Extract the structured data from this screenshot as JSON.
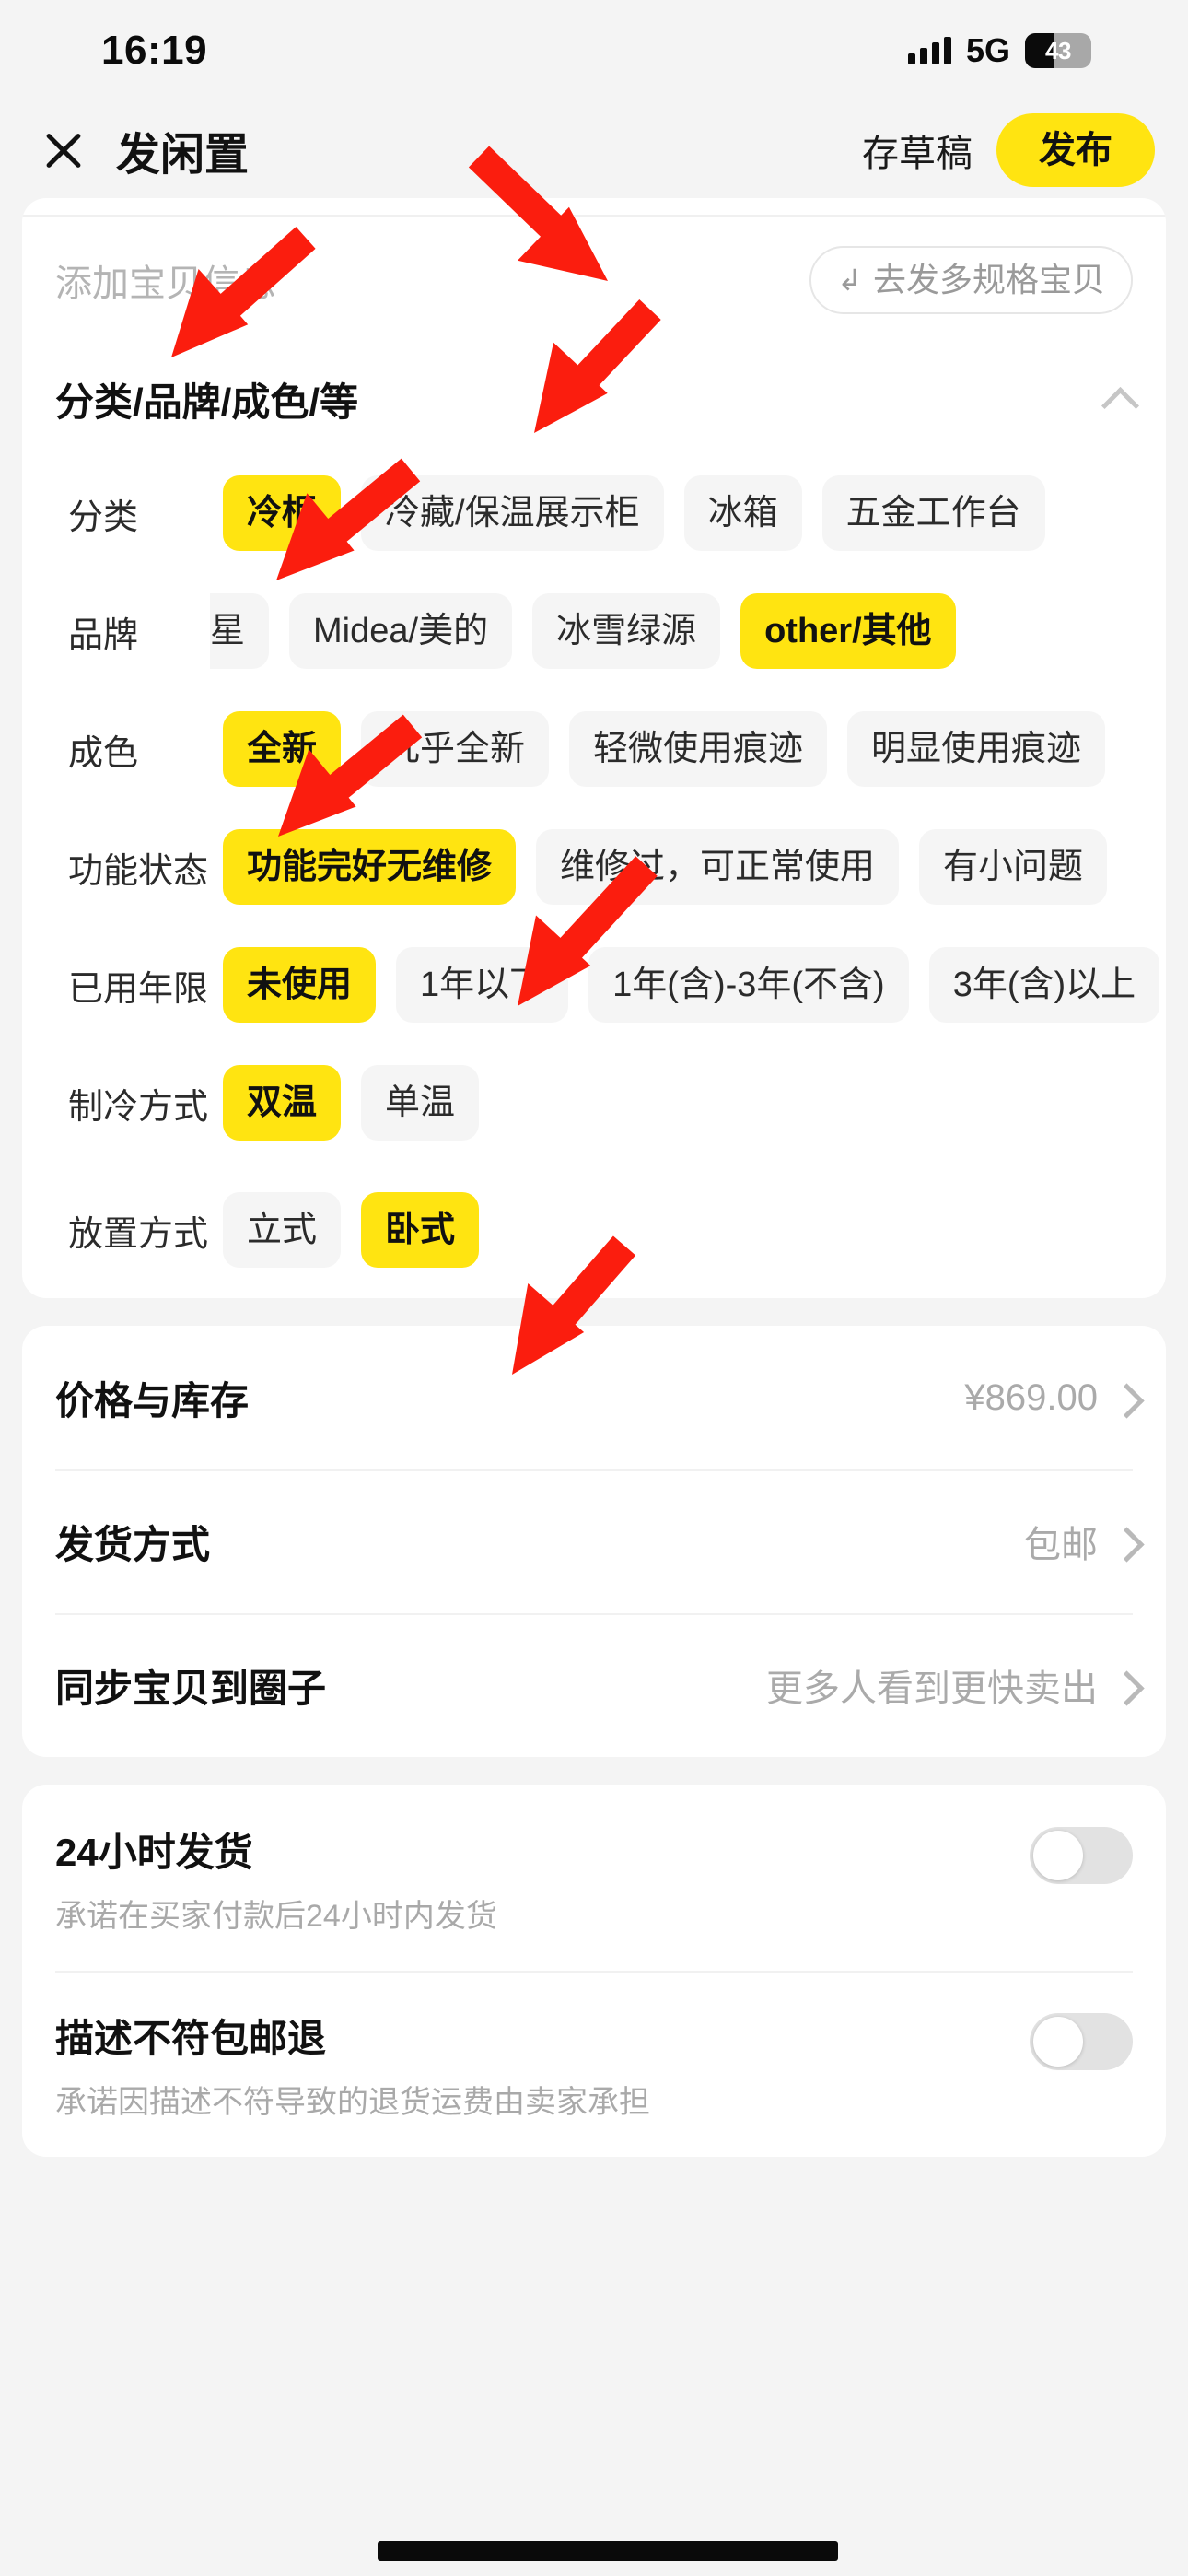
{
  "status_bar": {
    "time": "16:19",
    "network": "5G",
    "battery_percent": "43",
    "signal_icon": "signal-bars-icon"
  },
  "nav": {
    "close_icon": "close-icon",
    "title": "发闲置",
    "draft_label": "存草稿",
    "publish_label": "发布"
  },
  "add_info": {
    "placeholder": "添加宝贝信息",
    "multi_spec_label": "去发多规格宝贝",
    "multi_spec_icon": "arrow-turn-icon"
  },
  "attributes_section": {
    "title": "分类/品牌/成色/等",
    "collapse_icon": "chevron-up-icon",
    "rows": [
      {
        "label": "分类",
        "options": [
          {
            "text": "冷柜",
            "selected": true
          },
          {
            "text": "冷藏/保温展示柜",
            "selected": false
          },
          {
            "text": "冰箱",
            "selected": false
          },
          {
            "text": "五金工作台",
            "selected": false
          }
        ]
      },
      {
        "label": "品牌",
        "clipped_first": "星",
        "options": [
          {
            "text": "Midea/美的",
            "selected": false
          },
          {
            "text": "冰雪绿源",
            "selected": false
          },
          {
            "text": "other/其他",
            "selected": true
          }
        ]
      },
      {
        "label": "成色",
        "options": [
          {
            "text": "全新",
            "selected": true
          },
          {
            "text": "几乎全新",
            "selected": false
          },
          {
            "text": "轻微使用痕迹",
            "selected": false
          },
          {
            "text": "明显使用痕迹",
            "selected": false
          }
        ]
      },
      {
        "label": "功能状态",
        "options": [
          {
            "text": "功能完好无维修",
            "selected": true
          },
          {
            "text": "维修过，可正常使用",
            "selected": false
          },
          {
            "text": "有小问题",
            "selected": false
          }
        ]
      },
      {
        "label": "已用年限",
        "options": [
          {
            "text": "未使用",
            "selected": true
          },
          {
            "text": "1年以下",
            "selected": false
          },
          {
            "text": "1年(含)-3年(不含)",
            "selected": false
          },
          {
            "text": "3年(含)以上",
            "selected": false
          }
        ]
      },
      {
        "label": "制冷方式",
        "options": [
          {
            "text": "双温",
            "selected": true
          },
          {
            "text": "单温",
            "selected": false
          }
        ]
      },
      {
        "label": "放置方式",
        "options": [
          {
            "text": "立式",
            "selected": false
          },
          {
            "text": "卧式",
            "selected": true
          }
        ]
      }
    ]
  },
  "detail_rows": [
    {
      "label": "价格与库存",
      "value": "¥869.00"
    },
    {
      "label": "发货方式",
      "value": "包邮"
    },
    {
      "label": "同步宝贝到圈子",
      "value": "更多人看到更快卖出"
    }
  ],
  "switch_rows": [
    {
      "title": "24小时发货",
      "subtitle": "承诺在买家付款后24小时内发货",
      "on": false
    },
    {
      "title": "描述不符包邮退",
      "subtitle": "承诺因描述不符导致的退货运费由卖家承担",
      "on": false
    }
  ],
  "colors": {
    "accent_yellow": "#ffe411",
    "page_background": "#f4f4f4",
    "card_background": "#ffffff",
    "annotation_red": "#fb1d0e"
  }
}
